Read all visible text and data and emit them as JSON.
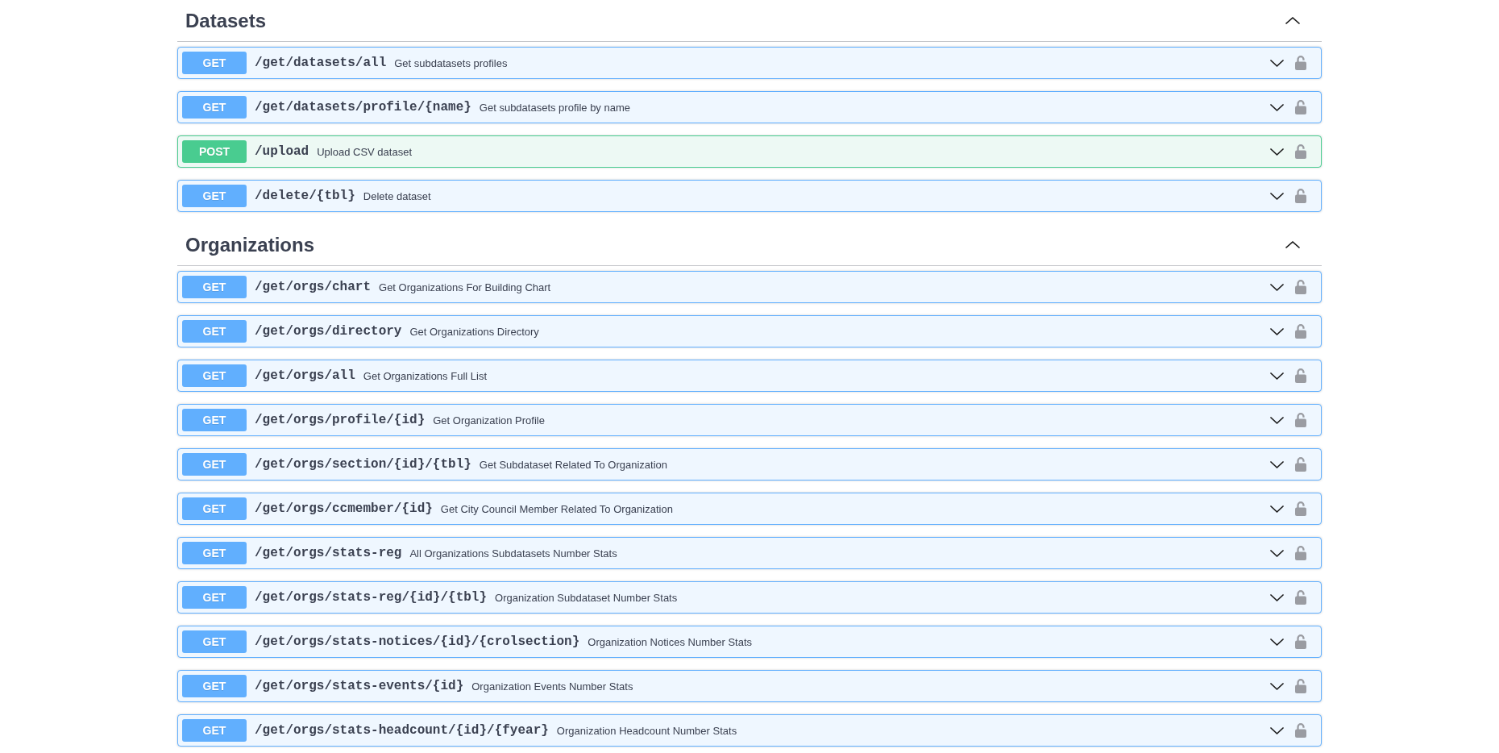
{
  "sections": [
    {
      "title": "Datasets",
      "expanded": true,
      "operations": [
        {
          "kind": "get",
          "method": "GET",
          "path": "/get/datasets/all",
          "summary": "Get subdatasets profiles",
          "expanded": false,
          "locked": false
        },
        {
          "kind": "get",
          "method": "GET",
          "path": "/get/datasets/profile/{name}",
          "summary": "Get subdatasets profile by name",
          "expanded": false,
          "locked": false
        },
        {
          "kind": "post",
          "method": "POST",
          "path": "/upload",
          "summary": "Upload CSV dataset",
          "expanded": false,
          "locked": false
        },
        {
          "kind": "get",
          "method": "GET",
          "path": "/delete/{tbl}",
          "summary": "Delete dataset",
          "expanded": false,
          "locked": false
        }
      ]
    },
    {
      "title": "Organizations",
      "expanded": true,
      "operations": [
        {
          "kind": "get",
          "method": "GET",
          "path": "/get/orgs/chart",
          "summary": "Get Organizations For Building Chart",
          "expanded": false,
          "locked": false
        },
        {
          "kind": "get",
          "method": "GET",
          "path": "/get/orgs/directory",
          "summary": "Get Organizations Directory",
          "expanded": false,
          "locked": false
        },
        {
          "kind": "get",
          "method": "GET",
          "path": "/get/orgs/all",
          "summary": "Get Organizations Full List",
          "expanded": false,
          "locked": false
        },
        {
          "kind": "get",
          "method": "GET",
          "path": "/get/orgs/profile/{id}",
          "summary": "Get Organization Profile",
          "expanded": false,
          "locked": false
        },
        {
          "kind": "get",
          "method": "GET",
          "path": "/get/orgs/section/{id}/{tbl}",
          "summary": "Get Subdataset Related To Organization",
          "expanded": false,
          "locked": false
        },
        {
          "kind": "get",
          "method": "GET",
          "path": "/get/orgs/ccmember/{id}",
          "summary": "Get City Council Member Related To Organization",
          "expanded": false,
          "locked": false
        },
        {
          "kind": "get",
          "method": "GET",
          "path": "/get/orgs/stats-reg",
          "summary": "All Organizations Subdatasets Number Stats",
          "expanded": false,
          "locked": false
        },
        {
          "kind": "get",
          "method": "GET",
          "path": "/get/orgs/stats-reg/{id}/{tbl}",
          "summary": "Organization Subdataset Number Stats",
          "expanded": false,
          "locked": false
        },
        {
          "kind": "get",
          "method": "GET",
          "path": "/get/orgs/stats-notices/{id}/{crolsection}",
          "summary": "Organization Notices Number Stats",
          "expanded": false,
          "locked": false
        },
        {
          "kind": "get",
          "method": "GET",
          "path": "/get/orgs/stats-events/{id}",
          "summary": "Organization Events Number Stats",
          "expanded": false,
          "locked": false
        },
        {
          "kind": "get",
          "method": "GET",
          "path": "/get/orgs/stats-headcount/{id}/{fyear}",
          "summary": "Organization Headcount Number Stats",
          "expanded": false,
          "locked": false
        }
      ]
    }
  ]
}
